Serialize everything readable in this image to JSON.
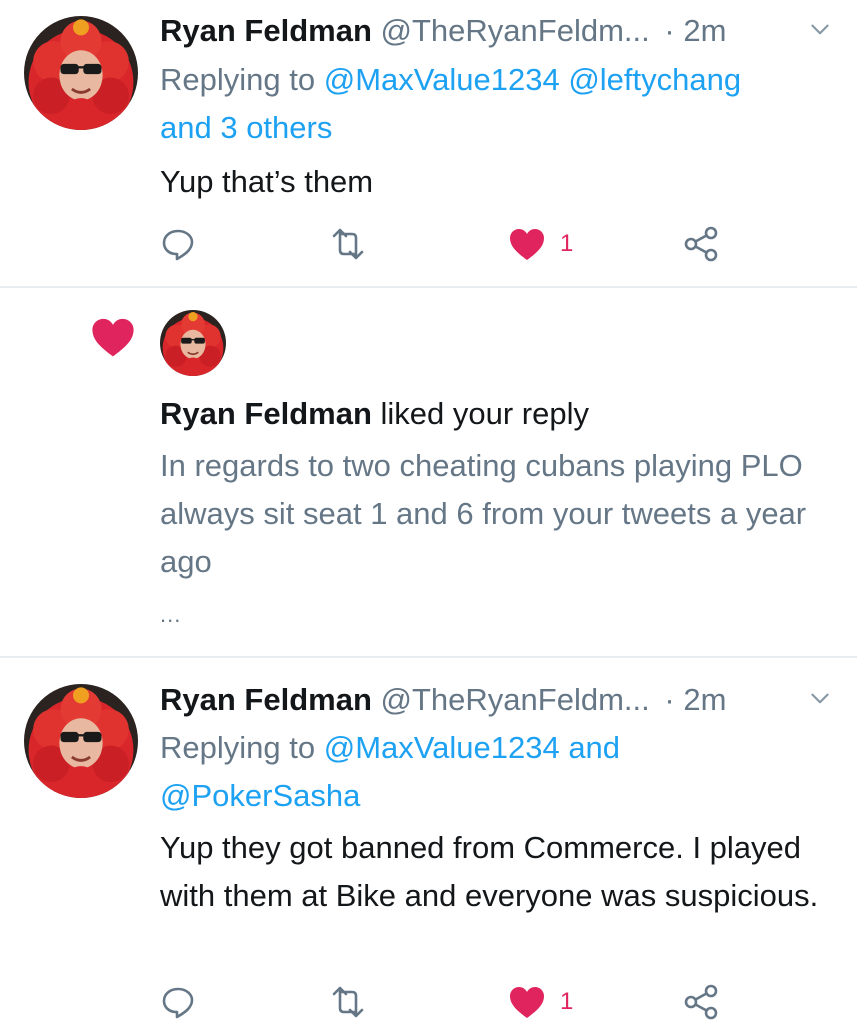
{
  "colors": {
    "accent": "#1da1f2",
    "secondary_text": "#657786",
    "like_red": "#e0245e",
    "divider": "#e6ecf0"
  },
  "tweet1": {
    "name": "Ryan Feldman",
    "handle": "@TheRyanFeldm...",
    "dot": "·",
    "time": "2m",
    "replying_prefix": "Replying to",
    "mention_a": "@MaxValue1234",
    "mention_b": "@leftychang",
    "mention_c": "and 3 others",
    "text": "Yup that’s them",
    "like_count": "1",
    "icons": [
      "reply-icon",
      "retweet-icon",
      "heart-icon",
      "share-icon",
      "chevron-down-icon"
    ]
  },
  "notification": {
    "name": "Ryan Feldman",
    "action_text": "liked your reply",
    "quoted_text": "In regards to two cheating cubans playing PLO always sit seat 1 and 6 from your tweets a year ago",
    "ellipsis": "...",
    "icons": [
      "heart-icon",
      "avatar"
    ]
  },
  "tweet2": {
    "name": "Ryan Feldman",
    "handle": "@TheRyanFeldm...",
    "dot": "·",
    "time": "2m",
    "replying_prefix": "Replying to",
    "mention_a": "@MaxValue1234 and",
    "mention_b": "@PokerSasha",
    "text": "Yup they got banned from Commerce. I played with them at Bike and everyone was suspicious.",
    "like_count": "1",
    "icons": [
      "reply-icon",
      "retweet-icon",
      "heart-icon",
      "share-icon",
      "chevron-down-icon"
    ]
  }
}
